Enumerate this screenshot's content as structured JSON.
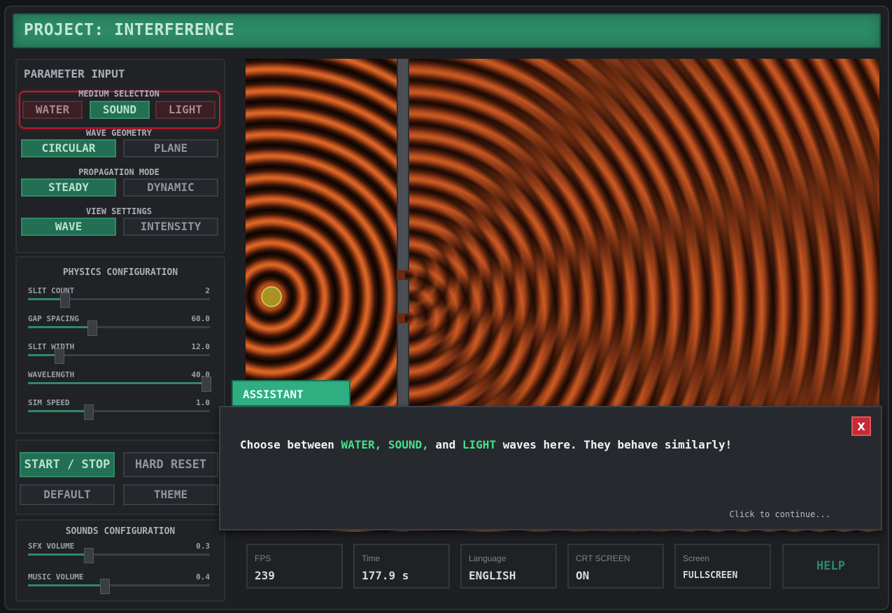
{
  "header": {
    "title": "PROJECT: INTERFERENCE"
  },
  "parameter_input": {
    "title": "PARAMETER INPUT",
    "medium_selection": {
      "label": "MEDIUM SELECTION",
      "options": [
        "WATER",
        "SOUND",
        "LIGHT"
      ],
      "selected": "SOUND"
    },
    "wave_geometry": {
      "label": "WAVE GEOMETRY",
      "options": [
        "CIRCULAR",
        "PLANE"
      ],
      "selected": "CIRCULAR"
    },
    "propagation_mode": {
      "label": "PROPAGATION MODE",
      "options": [
        "STEADY",
        "DYNAMIC"
      ],
      "selected": "STEADY"
    },
    "view_settings": {
      "label": "VIEW SETTINGS",
      "options": [
        "WAVE",
        "INTENSITY"
      ],
      "selected": "WAVE"
    }
  },
  "physics_configuration": {
    "title": "PHYSICS CONFIGURATION",
    "sliders": [
      {
        "label": "SLIT COUNT",
        "value": "2",
        "fraction": 0.2
      },
      {
        "label": "GAP SPACING",
        "value": "60.0",
        "fraction": 0.35
      },
      {
        "label": "SLIT WIDTH",
        "value": "12.0",
        "fraction": 0.17
      },
      {
        "label": "WAVELENGTH",
        "value": "40.0",
        "fraction": 1.0
      },
      {
        "label": "SIM SPEED",
        "value": "1.0",
        "fraction": 0.33
      }
    ]
  },
  "controls": {
    "start_stop": "START / STOP",
    "hard_reset": "HARD RESET",
    "default": "DEFAULT",
    "theme": "THEME"
  },
  "sounds_configuration": {
    "title": "SOUNDS CONFIGURATION",
    "sliders": [
      {
        "label": "SFX VOLUME",
        "value": "0.3",
        "fraction": 0.33
      },
      {
        "label": "MUSIC VOLUME",
        "value": "0.4",
        "fraction": 0.42
      }
    ]
  },
  "assistant": {
    "tab_label": "ASSISTANT",
    "message_start": "Choose between ",
    "highlight_1": "WATER, SOUND,",
    "message_mid": " and ",
    "highlight_2": "LIGHT",
    "message_end": " waves here. They behave similarly!",
    "close_label": "X",
    "continue_label": "Click to continue..."
  },
  "status_bar": {
    "fps": {
      "label": "FPS",
      "value": "239"
    },
    "time": {
      "label": "Time",
      "value": "177.9 s"
    },
    "language": {
      "label": "Language",
      "value": "ENGLISH"
    },
    "crt": {
      "label": "CRT SCREEN",
      "value": "ON"
    },
    "screen": {
      "label": "Screen",
      "value": "FULLSCREEN"
    },
    "help_label": "HELP"
  },
  "colors": {
    "accent": "#2c8a66",
    "highlight": "#46e08c",
    "alert": "#c0192c",
    "wave": "#c1531e"
  }
}
